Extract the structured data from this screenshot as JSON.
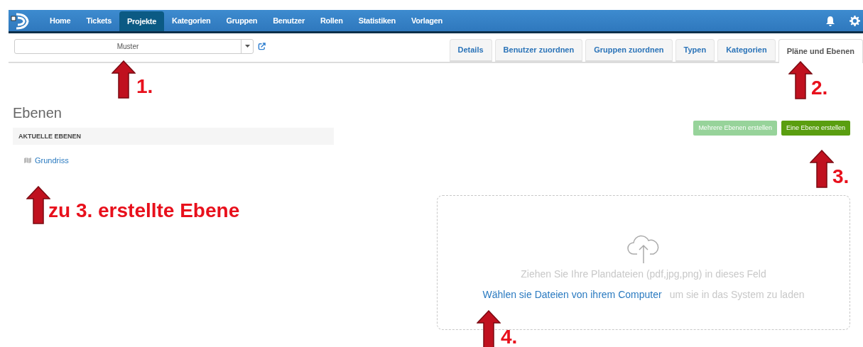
{
  "navbar": {
    "items": [
      {
        "label": "Home",
        "selected": false
      },
      {
        "label": "Tickets",
        "selected": false
      },
      {
        "label": "Projekte",
        "selected": true
      },
      {
        "label": "Kategorien",
        "selected": false
      },
      {
        "label": "Gruppen",
        "selected": false
      },
      {
        "label": "Benutzer",
        "selected": false
      },
      {
        "label": "Rollen",
        "selected": false
      },
      {
        "label": "Statistiken",
        "selected": false
      },
      {
        "label": "Vorlagen",
        "selected": false
      }
    ]
  },
  "project_select": {
    "value": "Muster"
  },
  "tabs": [
    {
      "label": "Details",
      "selected": false
    },
    {
      "label": "Benutzer zuordnen",
      "selected": false
    },
    {
      "label": "Gruppen zuordnen",
      "selected": false
    },
    {
      "label": "Typen",
      "selected": false
    },
    {
      "label": "Kategorien",
      "selected": false
    },
    {
      "label": "Pläne und Ebenen",
      "selected": true
    }
  ],
  "section": {
    "title": "Ebenen",
    "list_header": "AKTUELLE EBENEN",
    "layers": [
      {
        "name": "Grundriss"
      }
    ]
  },
  "buttons": [
    {
      "label": "Mehrere Ebenen erstellen",
      "disabled": true
    },
    {
      "label": "Eine Ebene erstellen",
      "disabled": false
    }
  ],
  "dropzone": {
    "hint": "Ziehen Sie Ihre Plandateien (pdf,jpg,png) in dieses Feld",
    "link": "Wählen sie Dateien von ihrem Computer",
    "suffix": "um sie in das System zu laden"
  },
  "annotations": [
    {
      "label": "1."
    },
    {
      "label": "2."
    },
    {
      "label": "3."
    },
    {
      "label": "zu 3. erstellte Ebene"
    },
    {
      "label": "4."
    }
  ]
}
